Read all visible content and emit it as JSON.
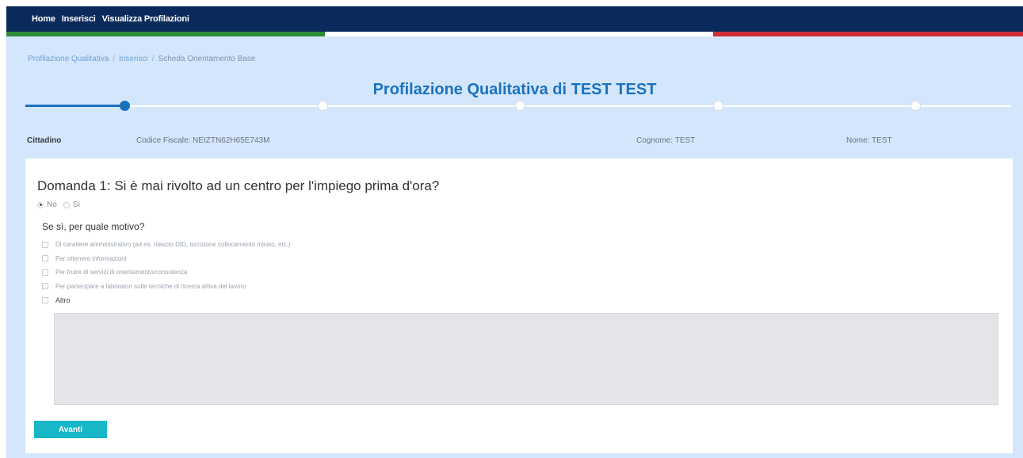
{
  "navbar": {
    "items": [
      "Home",
      "Inserisci",
      "Visualizza Profilazioni"
    ]
  },
  "breadcrumb": [
    "Profilazione Qualitativa",
    "Inserisci",
    "Scheda Orientamento Base"
  ],
  "breadcrumb_separator": "/",
  "title": "Profilazione Qualitativa di TEST TEST",
  "stepper": {
    "steps": 5,
    "current_step": 1,
    "progress": 0.1
  },
  "citizen": {
    "label": "Cittadino",
    "codice_fiscale": "Codice Fiscale: NEIZTN62H65E743M",
    "cognome": "Cognome: TEST",
    "nome": "Nome: TEST"
  },
  "question": {
    "title": "Domanda 1: Si è mai rivolto ad un centro per l'impiego prima d'ora?",
    "answer_options": [
      "No",
      "Sì"
    ],
    "selected": "No",
    "subquestion": "Se sì, per quale motivo?",
    "reasons": [
      "Di carattere amministrativo (ad es. rilascio DID, iscrizione collocamento mirato, etc.)",
      "Per ottenere informazioni",
      "Per fruire di servizi di orientamento/consulenza",
      "Per partecipare a laboratori sulle tecniche di ricerca attiva del lavoro",
      "Altro"
    ],
    "altro_text": ""
  },
  "buttons": {
    "next": "Avanti"
  },
  "colors": {
    "navbar": "#0b2a5c",
    "background": "#d4e6fb",
    "accent_blue": "#1a72bf",
    "button": "#17b7c7",
    "flag_green": "#2e8b3a",
    "flag_red": "#cf2d36"
  }
}
